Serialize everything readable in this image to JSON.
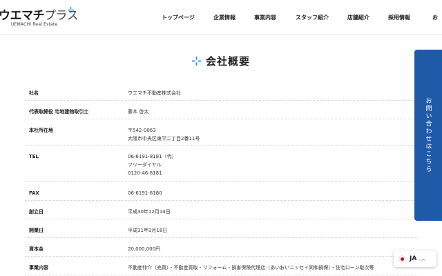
{
  "logo": {
    "name": "ウエマチ",
    "name_light": "プラス",
    "sub": "UEMACHI Real Estate"
  },
  "nav": {
    "items": [
      "トップページ",
      "企業情報",
      "事業内容",
      "スタッフ紹介",
      "店舗紹介",
      "採用情報",
      "お"
    ]
  },
  "page_title": "会社概要",
  "table": {
    "rows": [
      {
        "label": "社名",
        "lines": [
          "ウエマチ不動産株式会社"
        ]
      },
      {
        "label": "代表取締役 宅地建物取引士",
        "lines": [
          "藤本 啓太"
        ]
      },
      {
        "label": "本社所在地",
        "lines": [
          "〒542-0063",
          "大阪市中央区東平二丁目2番11号"
        ]
      },
      {
        "label": "TEL",
        "lines": [
          "06-6191-8181（代）",
          "フリーダイヤル",
          "0120-46-8181"
        ]
      },
      {
        "label": "FAX",
        "lines": [
          "06-6191-8180"
        ]
      },
      {
        "label": "創立日",
        "lines": [
          "平成30年12月14日"
        ]
      },
      {
        "label": "開業日",
        "lines": [
          "平成31年3月18日"
        ]
      },
      {
        "label": "資本金",
        "lines": [
          "20,000,000円"
        ]
      },
      {
        "label": "事業内容",
        "lines": [
          "不動産仲介（売買）・不動産買取・リフォーム・損害保険代理店（あいおいニッセイ同和損保）・住宅ローン取次等"
        ]
      }
    ]
  },
  "contact_tab": "お問い合わせはこちら",
  "lang": {
    "label": "JA"
  },
  "colors": {
    "accent": "#1e5aa8",
    "logo_mark": "#2a8fd8"
  }
}
